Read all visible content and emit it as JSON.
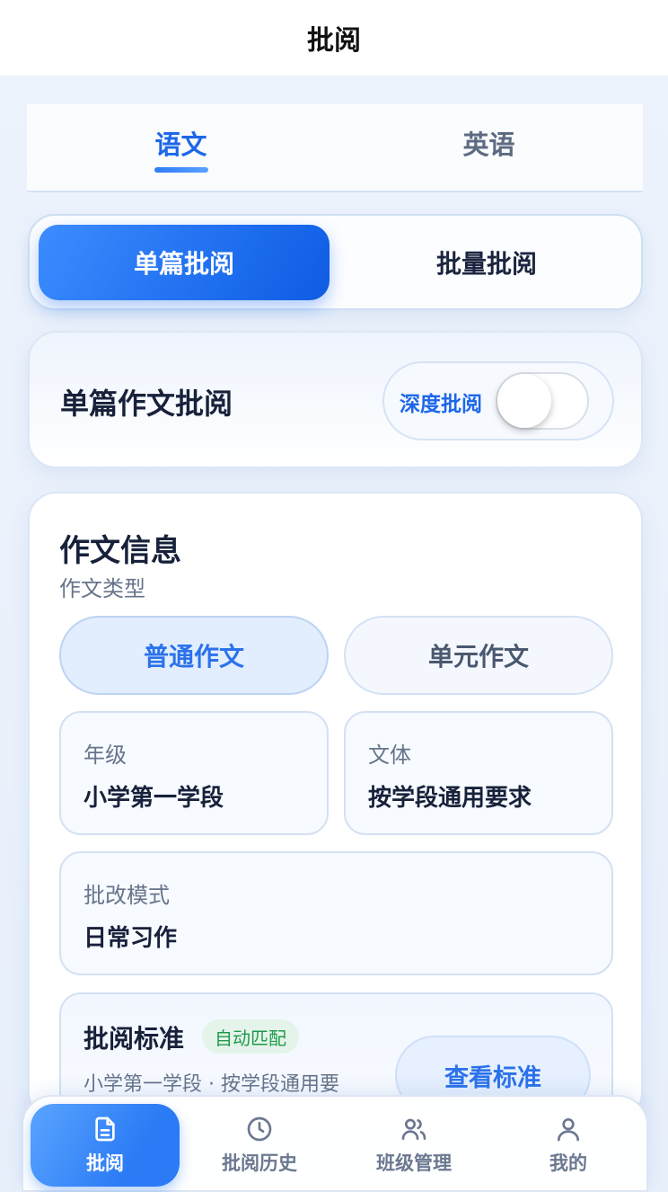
{
  "header": {
    "title": "批阅"
  },
  "subject_tabs": [
    {
      "label": "语文",
      "active": true
    },
    {
      "label": "英语",
      "active": false
    }
  ],
  "mode_switch": {
    "single_label": "单篇批阅",
    "batch_label": "批量批阅",
    "selected": "single"
  },
  "single_card": {
    "heading": "单篇作文批阅",
    "deep_review_label": "深度批阅",
    "deep_review_on": false
  },
  "essay_info": {
    "title": "作文信息",
    "type_label": "作文类型",
    "types": [
      {
        "label": "普通作文",
        "selected": true
      },
      {
        "label": "单元作文",
        "selected": false
      }
    ],
    "grade": {
      "label": "年级",
      "value": "小学第一学段"
    },
    "genre": {
      "label": "文体",
      "value": "按学段通用要求"
    },
    "mode": {
      "label": "批改模式",
      "value": "日常习作"
    },
    "standard": {
      "title": "批阅标准",
      "badge": "自动匹配",
      "description": "小学第一学段 · 按学段通用要",
      "view_button": "查看标准"
    }
  },
  "bottom_nav": [
    {
      "label": "批阅",
      "icon": "document-icon",
      "active": true
    },
    {
      "label": "批阅历史",
      "icon": "clock-icon",
      "active": false
    },
    {
      "label": "班级管理",
      "icon": "users-icon",
      "active": false
    },
    {
      "label": "我的",
      "icon": "user-icon",
      "active": false
    }
  ],
  "colors": {
    "accent": "#1d67e8",
    "badge_green": "#1d9a4b",
    "text_primary": "#17213a",
    "text_secondary": "#66748b"
  }
}
